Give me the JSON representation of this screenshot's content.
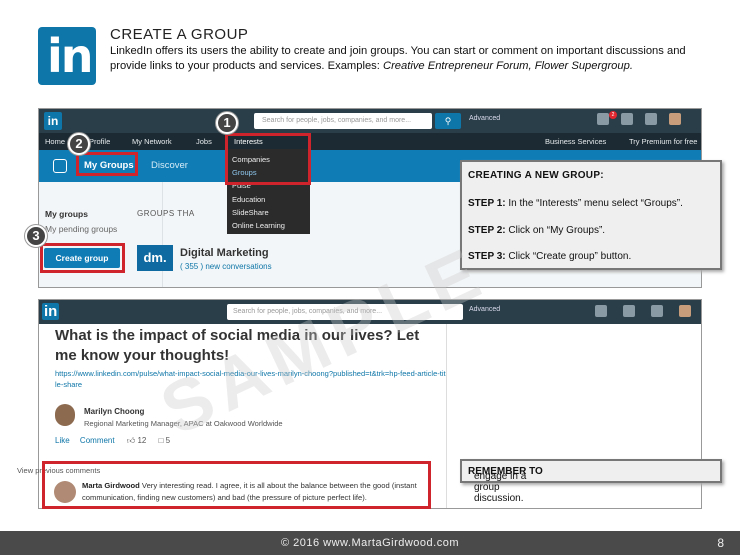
{
  "header": {
    "title": "CREATE A GROUP",
    "desc_main": "LinkedIn offers its users the ability to create and join groups. You can start or comment on important discussions and provide links to your products and services. Examples: ",
    "desc_examples": "Creative Entrepreneur Forum, Flower Supergroup."
  },
  "shot1": {
    "search_placeholder": "Search for people, jobs, companies, and more...",
    "advanced": "Advanced",
    "notification_count": "2",
    "nav": [
      "Home",
      "Profile",
      "My Network",
      "Jobs",
      "Interests",
      "Business Services",
      "Try Premium for free"
    ],
    "tabs": {
      "my_groups": "My Groups",
      "discover": "Discover"
    },
    "my_groups_heading": "My groups",
    "my_pending": "My pending groups",
    "create_button": "Create group",
    "groups_that": "GROUPS THA",
    "group_logo": "dm.",
    "group_name": "Digital Marketing",
    "group_conversations": "( 355 ) new conversations",
    "dropdown": [
      "Companies",
      "Groups",
      "Pulse",
      "Education",
      "SlideShare",
      "Online Learning"
    ],
    "dropdown_header": "Interests"
  },
  "steps": [
    "1",
    "2",
    "3"
  ],
  "callout": {
    "title": "CREATING A NEW GROUP:",
    "step1_label": "STEP 1:",
    "step1_text": " In the “Interests” menu select “Groups”.",
    "step2_label": "STEP 2:",
    "step2_text": " Click on “My Groups”.",
    "step3_label": "STEP 3:",
    "step3_text": " Click “Create group” button."
  },
  "shot2": {
    "logo": "in",
    "search_placeholder": "Search for people, jobs, companies, and more...",
    "advanced": "Advanced",
    "post_title": "What is the impact of social media in our lives? Let me know your thoughts!",
    "post_url": "https://www.linkedin.com/pulse/what-impact-social-media-our-lives-marilyn-choong?published=t&trk=hp-feed-article-title-share",
    "author_name": "Marilyn Choong",
    "author_role": "Regional Marketing Manager, APAC at Oakwood Worldwide",
    "like": "Like",
    "comment": "Comment",
    "likes_count": "12",
    "comments_count": "5",
    "view_previous": "View previous comments",
    "commenter": "Marta Girdwood",
    "comment_text": " Very interesting read. I agree, it is all about the balance between the good (instant communication, finding new customers) and bad (the pressure of picture perfect life)."
  },
  "callout2": {
    "label": "REMEMBER TO",
    "text": " engage in a group discussion."
  },
  "watermark": "SAMPLE",
  "footer": {
    "text": "© 2016 www.MartaGirdwood.com",
    "page": "8"
  },
  "colors": {
    "linkedin_blue": "#0e76a8",
    "highlight_red": "#d0242d"
  }
}
